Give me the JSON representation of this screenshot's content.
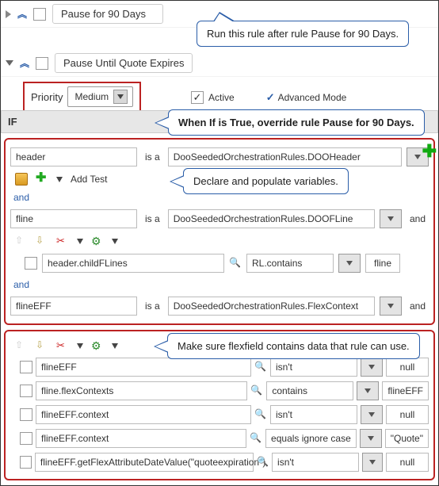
{
  "rule1": {
    "name": "Pause for 90 Days"
  },
  "rule2": {
    "name": "Pause Until Quote Expires"
  },
  "priority": {
    "label": "Priority",
    "value": "Medium"
  },
  "active": {
    "label": "Active"
  },
  "advanced": {
    "label": "Advanced Mode"
  },
  "if_label": "IF",
  "callouts": {
    "top": "Run this rule after rule Pause for 90 Days.",
    "if": "When If is True, override rule Pause for 90 Days.",
    "declare": "Declare and populate variables.",
    "flex": "Make sure flexfield contains data that rule can use."
  },
  "add_test_label": "Add Test",
  "is_a": "is a",
  "and": "and",
  "declare_block": {
    "header": {
      "name": "header",
      "type": "DooSeededOrchestrationRules.DOOHeader"
    },
    "fline": {
      "name": "fline",
      "type": "DooSeededOrchestrationRules.DOOFLine"
    },
    "child": {
      "lhs": "header.childFLines",
      "op": "RL.contains",
      "rhs": "fline"
    },
    "flineEFF": {
      "name": "flineEFF",
      "type": "DooSeededOrchestrationRules.FlexContext"
    }
  },
  "tests": [
    {
      "lhs": "flineEFF",
      "op": "isn't",
      "rhs": "null"
    },
    {
      "lhs": "fline.flexContexts",
      "op": "contains",
      "rhs": "flineEFF"
    },
    {
      "lhs": "flineEFF.context",
      "op": "isn't",
      "rhs": "null"
    },
    {
      "lhs": "flineEFF.context",
      "op": "equals ignore case",
      "rhs": "\"Quote\""
    },
    {
      "lhs": "flineEFF.getFlexAttributeDateValue(\"quoteexpiration\")",
      "op": "isn't",
      "rhs": "null"
    }
  ]
}
